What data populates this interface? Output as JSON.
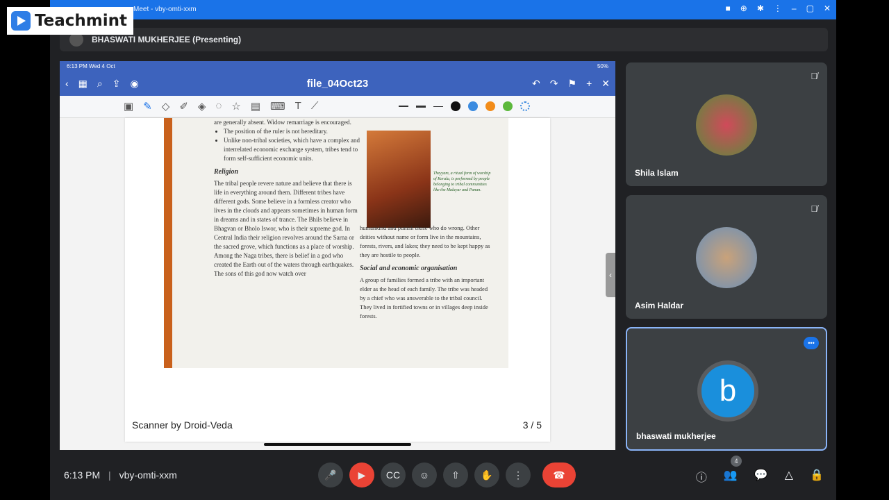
{
  "titlebar": {
    "title": "Meet - vby-omti-xxm",
    "icons": [
      "camera-icon",
      "zoom-icon",
      "extension-icon",
      "more-icon",
      "minimize-icon",
      "restore-icon",
      "close-icon"
    ]
  },
  "logo": {
    "text": "Teachmint"
  },
  "presenter": {
    "name": "BHASWATI MUKHERJEE (Presenting)"
  },
  "ipad": {
    "time": "6:13 PM  Wed 4 Oct",
    "battery": "50%",
    "file_title": "file_04Oct23",
    "swatches": [
      "#111111",
      "#3b8be0",
      "#f28c1a",
      "#5cb83c"
    ]
  },
  "document": {
    "col1_lines": [
      "are generally absent. Widow remarriage is encouraged.",
      "The position of the ruler is not hereditary.",
      "Unlike non-tribal societies, which have a complex and interrelated economic exchange system, tribes tend to form self-sufficient economic units."
    ],
    "religion_heading": "Religion",
    "religion_text": "The tribal people revere nature and believe that there is life in everything around them. Different tribes have different gods. Some believe in a formless creator who lives in the clouds and appears sometimes in human form in dreams and in states of trance. The Bhils believe in Bhagvan or Bholo Iswor, who is their supreme god. In Central India their religion revolves around the Sarna or the sacred grove, which functions as a place of worship.",
    "naga_text": "Among the Naga tribes, there is belief in a god who created the Earth out of the waters through earthquakes. The sons of this god now watch over",
    "caption": "Theyyam, a ritual form of worship of Kerala, is performed by people belonging to tribal communities like the Malayar and Panan.",
    "col2_text": "humankind and punish those who do wrong. Other deities without name or form live in the mountains, forests, rivers, and lakes; they need to be kept happy as they are hostile to people.",
    "social_heading": "Social and economic organisation",
    "social_text": "A group of families formed a tribe with an important elder as the head of each family. The tribe was headed by a chief who was answerable to the tribal council. They lived in fortified towns or in villages deep inside forests.",
    "scanner": "Scanner by Droid-Veda",
    "page": "3 / 5"
  },
  "participants": [
    {
      "name": "Shila Islam",
      "muted": true
    },
    {
      "name": "Asim Haldar",
      "muted": true
    },
    {
      "name": "bhaswati mukherjee",
      "initial": "b",
      "speaking": true
    }
  ],
  "bottombar": {
    "time": "6:13 PM",
    "meeting_code": "vby-omti-xxm",
    "people_count": "4"
  }
}
